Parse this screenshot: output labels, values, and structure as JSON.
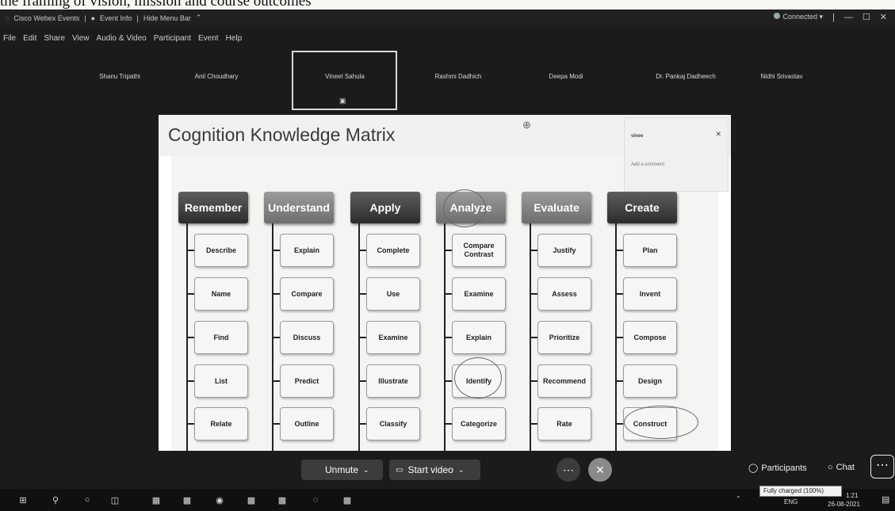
{
  "document_strip": {
    "text": "the framing of vision, mission and course outcomes"
  },
  "titlebar": {
    "app_title": "Cisco Webex Events",
    "event_info": "Event Info",
    "hide_menu": "Hide Menu Bar",
    "status": "Connected",
    "window_controls": [
      "—",
      "☐",
      "✕"
    ]
  },
  "menu": [
    "File",
    "Edit",
    "Share",
    "View",
    "Audio & Video",
    "Participant",
    "Event",
    "Help"
  ],
  "participants": [
    "Shanu Tripathi",
    "Anil Choudhary",
    "Vineet Sahula",
    "Rashmi Dadhich",
    "Deepa Modi",
    "Dr. Pankaj Dadheech",
    "Nidhi Srivastav"
  ],
  "slide": {
    "title": "Cognition Knowledge Matrix",
    "comment": {
      "user": "vinee",
      "placeholder": "Add a comment"
    },
    "columns": [
      {
        "heading": "Remember",
        "items": [
          "Describe",
          "Name",
          "Find",
          "List",
          "Relate"
        ]
      },
      {
        "heading": "Understand",
        "items": [
          "Explain",
          "Compare",
          "Discuss",
          "Predict",
          "Outline"
        ]
      },
      {
        "heading": "Apply",
        "items": [
          "Complete",
          "Use",
          "Examine",
          "Illustrate",
          "Classify"
        ]
      },
      {
        "heading": "Analyze",
        "items": [
          "Compare Contrast",
          "Examine",
          "Explain",
          "Identify",
          "Categorize"
        ]
      },
      {
        "heading": "Evaluate",
        "items": [
          "Justify",
          "Assess",
          "Prioritize",
          "Recommend",
          "Rate"
        ]
      },
      {
        "heading": "Create",
        "items": [
          "Plan",
          "Invent",
          "Compose",
          "Design",
          "Construct"
        ]
      }
    ]
  },
  "controls": {
    "unmute": "Unmute",
    "start_video": "Start video",
    "participants": "Participants",
    "chat": "Chat"
  },
  "taskbar": {
    "tray_lang": "ENG",
    "time": "1:21",
    "date": "26-08-2021",
    "battery_tooltip": "Fully charged (100%)"
  }
}
